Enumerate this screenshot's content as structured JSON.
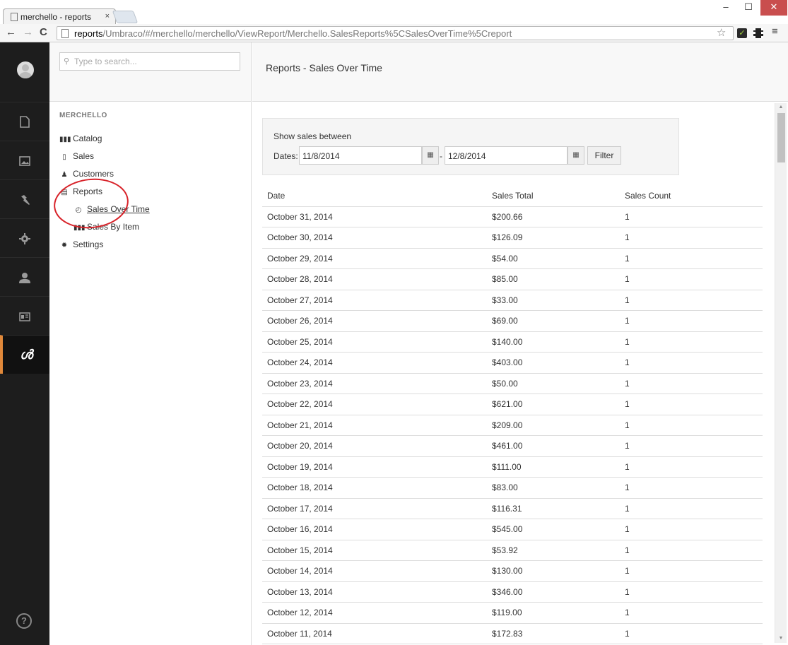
{
  "browser": {
    "tab_title": "merchello - reports",
    "tab_close": "×",
    "url_host": "reports",
    "url_path": "/Umbraco/#/merchello/merchello/ViewReport/Merchello.SalesReports%5CSalesOverTime%5Creport",
    "win_min": "–",
    "win_max": "☐",
    "win_close": "✕"
  },
  "appbar": {
    "items": [
      "content-icon",
      "media-icon",
      "wrench-icon",
      "gear-icon",
      "user-icon",
      "contact-card-icon",
      "merchello-icon"
    ],
    "active_glyph": "ൾ",
    "help": "?"
  },
  "tree": {
    "search_placeholder": "Type to search...",
    "section": "MERCHELLO",
    "items": [
      {
        "label": "Catalog",
        "glyph": "▮▮▮"
      },
      {
        "label": "Sales",
        "glyph": "▯"
      },
      {
        "label": "Customers",
        "glyph": "♟"
      },
      {
        "label": "Reports",
        "glyph": "▤"
      },
      {
        "label": "Sales Over Time",
        "glyph": "◴"
      },
      {
        "label": "Sales By Item",
        "glyph": "▮▮▮"
      },
      {
        "label": "Settings",
        "glyph": "✹"
      }
    ]
  },
  "main": {
    "title": "Reports - Sales Over Time",
    "filter": {
      "caption": "Show sales between",
      "dates_label": "Dates:",
      "from": "11/8/2014",
      "separator": "-",
      "to": "12/8/2014",
      "button": "Filter"
    },
    "table": {
      "headers": [
        "Date",
        "Sales Total",
        "Sales Count"
      ],
      "rows": [
        [
          "October 31, 2014",
          "$200.66",
          "1"
        ],
        [
          "October 30, 2014",
          "$126.09",
          "1"
        ],
        [
          "October 29, 2014",
          "$54.00",
          "1"
        ],
        [
          "October 28, 2014",
          "$85.00",
          "1"
        ],
        [
          "October 27, 2014",
          "$33.00",
          "1"
        ],
        [
          "October 26, 2014",
          "$69.00",
          "1"
        ],
        [
          "October 25, 2014",
          "$140.00",
          "1"
        ],
        [
          "October 24, 2014",
          "$403.00",
          "1"
        ],
        [
          "October 23, 2014",
          "$50.00",
          "1"
        ],
        [
          "October 22, 2014",
          "$621.00",
          "1"
        ],
        [
          "October 21, 2014",
          "$209.00",
          "1"
        ],
        [
          "October 20, 2014",
          "$461.00",
          "1"
        ],
        [
          "October 19, 2014",
          "$111.00",
          "1"
        ],
        [
          "October 18, 2014",
          "$83.00",
          "1"
        ],
        [
          "October 17, 2014",
          "$116.31",
          "1"
        ],
        [
          "October 16, 2014",
          "$545.00",
          "1"
        ],
        [
          "October 15, 2014",
          "$53.92",
          "1"
        ],
        [
          "October 14, 2014",
          "$130.00",
          "1"
        ],
        [
          "October 13, 2014",
          "$346.00",
          "1"
        ],
        [
          "October 12, 2014",
          "$119.00",
          "1"
        ],
        [
          "October 11, 2014",
          "$172.83",
          "1"
        ]
      ]
    }
  }
}
